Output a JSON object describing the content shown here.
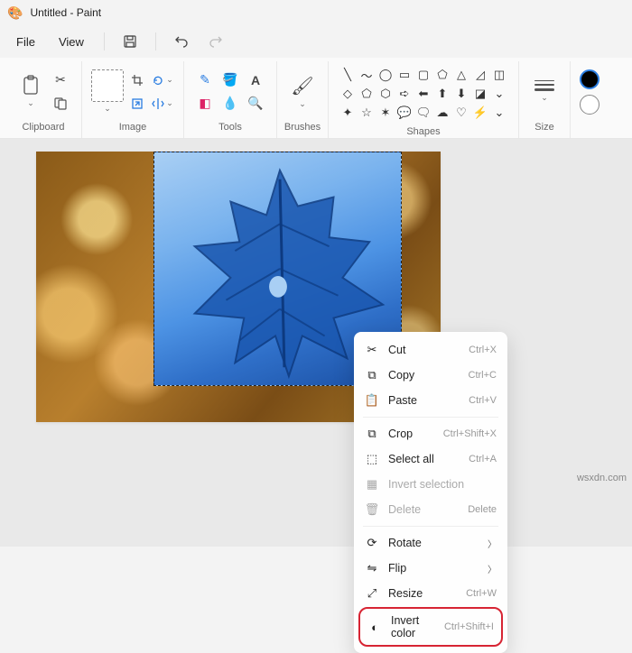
{
  "title": "Untitled - Paint",
  "menus": {
    "file": "File",
    "view": "View"
  },
  "ribbon": {
    "clipboard": "Clipboard",
    "image": "Image",
    "tools": "Tools",
    "brushes": "Brushes",
    "shapes": "Shapes",
    "size": "Size"
  },
  "context_menu": {
    "cut": {
      "label": "Cut",
      "shortcut": "Ctrl+X"
    },
    "copy": {
      "label": "Copy",
      "shortcut": "Ctrl+C"
    },
    "paste": {
      "label": "Paste",
      "shortcut": "Ctrl+V"
    },
    "crop": {
      "label": "Crop",
      "shortcut": "Ctrl+Shift+X"
    },
    "select_all": {
      "label": "Select all",
      "shortcut": "Ctrl+A"
    },
    "invert_selection": {
      "label": "Invert selection",
      "shortcut": ""
    },
    "delete": {
      "label": "Delete",
      "shortcut": "Delete"
    },
    "rotate": {
      "label": "Rotate"
    },
    "flip": {
      "label": "Flip"
    },
    "resize": {
      "label": "Resize",
      "shortcut": "Ctrl+W"
    },
    "invert_color": {
      "label": "Invert color",
      "shortcut": "Ctrl+Shift+I"
    }
  },
  "watermark": "wsxdn.com"
}
